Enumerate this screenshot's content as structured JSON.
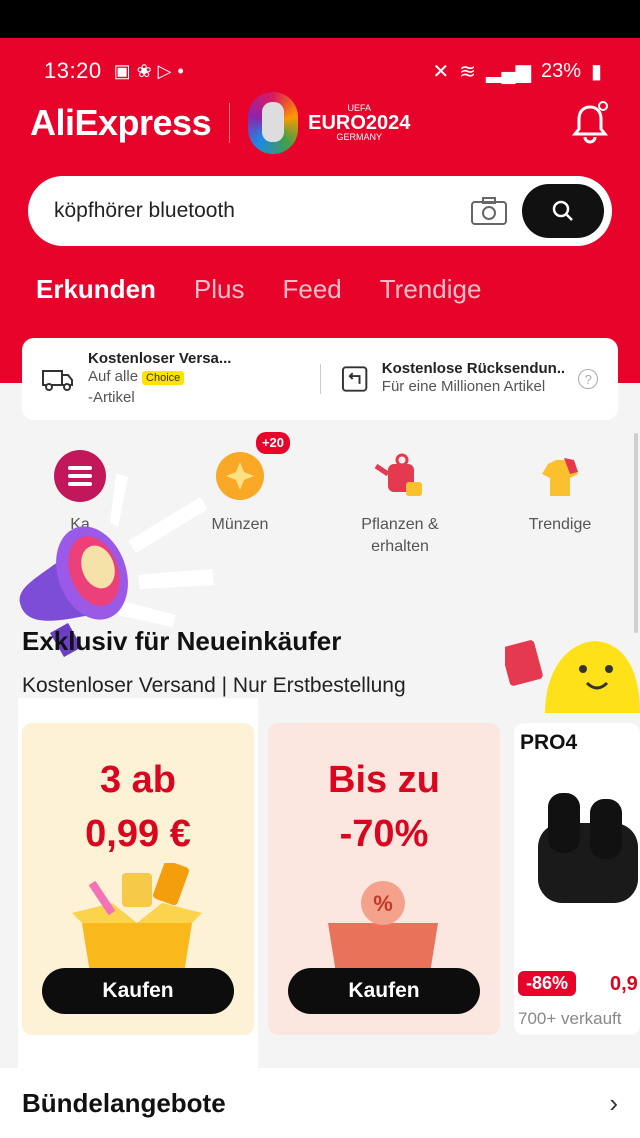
{
  "status": {
    "time": "13:20",
    "battery": "23%"
  },
  "brand": {
    "logo": "AliExpress",
    "event_top": "UEFA",
    "event_name": "EURO2024",
    "event_country": "GERMANY"
  },
  "search": {
    "query": "köpfhörer bluetooth"
  },
  "tabs": [
    {
      "label": "Erkunden"
    },
    {
      "label": "Plus"
    },
    {
      "label": "Feed"
    },
    {
      "label": "Trendige"
    }
  ],
  "promo": {
    "left_title": "Kostenloser Versa...",
    "left_sub_a": "Auf alle",
    "left_badge": "Choice",
    "left_sub_b": "-Artikel",
    "right_title": "Kostenlose Rücksendun...",
    "right_sub": "Für eine Millionen Artikel"
  },
  "categories": [
    {
      "label": "Ka",
      "icon": "menu-icon"
    },
    {
      "label": "Münzen",
      "icon": "coin-icon",
      "badge": "+20"
    },
    {
      "label": "Pflanzen &\nerhalten",
      "icon": "watering-can-icon"
    },
    {
      "label": "Trendige",
      "icon": "shirt-icon"
    }
  ],
  "section": {
    "title": "Exklusiv für Neueinkäufer",
    "subtitle": "Kostenloser Versand | Nur Erstbestellung"
  },
  "cards": [
    {
      "line1": "3 ab",
      "line2": "0,99 €",
      "button": "Kaufen"
    },
    {
      "line1": "Bis zu",
      "line2": "-70%",
      "button": "Kaufen"
    },
    {
      "title": "PRO4",
      "discount": "-86%",
      "price_partial": "0,9",
      "sold": "700+ verkauft"
    }
  ],
  "bundle": {
    "title": "Bündelangebote"
  },
  "colors": {
    "brand_red": "#e8032b",
    "price_red": "#d8061e",
    "button_black": "#0d0d0d",
    "choice_yellow": "#ffe300"
  }
}
